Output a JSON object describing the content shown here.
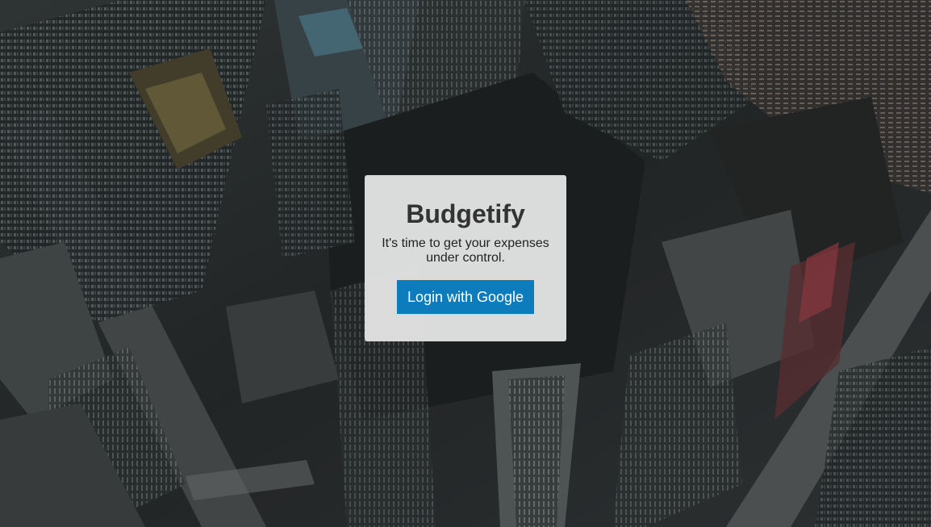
{
  "app": {
    "title": "Budgetify",
    "subtitle": "It's time to get your expenses under control.",
    "login_label": "Login with Google"
  },
  "colors": {
    "button_bg": "#0d7cbd",
    "button_text": "#ffffff",
    "box_bg": "#e1e1e1",
    "title_text": "#333333"
  },
  "background": {
    "description_icon": "city-aerial-night-photo"
  }
}
